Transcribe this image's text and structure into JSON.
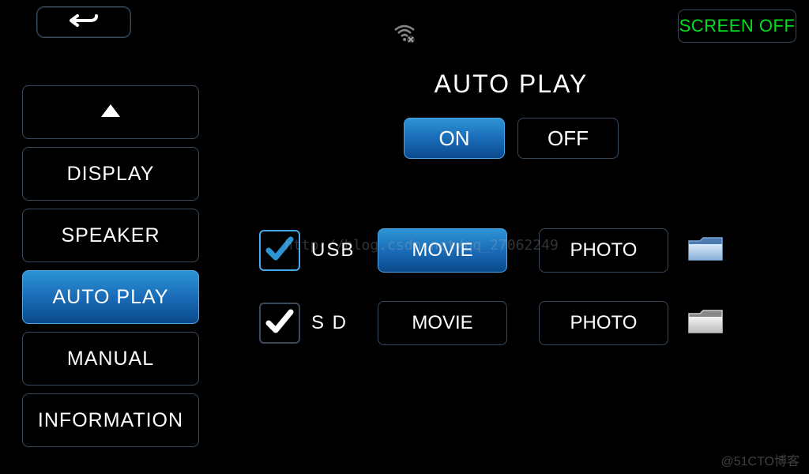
{
  "topbar": {
    "screen_off_label": "SCREEN OFF"
  },
  "sidebar": {
    "items": [
      {
        "label": "DISPLAY",
        "active": false
      },
      {
        "label": "SPEAKER",
        "active": false
      },
      {
        "label": "AUTO PLAY",
        "active": true
      },
      {
        "label": "MANUAL",
        "active": false
      },
      {
        "label": "INFORMATION",
        "active": false
      }
    ]
  },
  "content": {
    "title": "AUTO PLAY",
    "toggle": {
      "on_label": "ON",
      "off_label": "OFF",
      "active": "on"
    },
    "rows": [
      {
        "label": "USB",
        "checked": true,
        "check_color": "blue",
        "folder_style": "blue",
        "buttons": [
          {
            "label": "MOVIE",
            "active": true
          },
          {
            "label": "PHOTO",
            "active": false
          }
        ]
      },
      {
        "label": "S D",
        "checked": true,
        "check_color": "white",
        "folder_style": "gray",
        "buttons": [
          {
            "label": "MOVIE",
            "active": false
          },
          {
            "label": "PHOTO",
            "active": false
          }
        ]
      }
    ]
  },
  "watermarks": {
    "url": "http://blog.csdn.net/qq_27062249",
    "credit": "@51CTO博客"
  },
  "colors": {
    "accent_blue": "#1a6cb8",
    "border": "#3a4a5a",
    "green": "#00e020"
  }
}
